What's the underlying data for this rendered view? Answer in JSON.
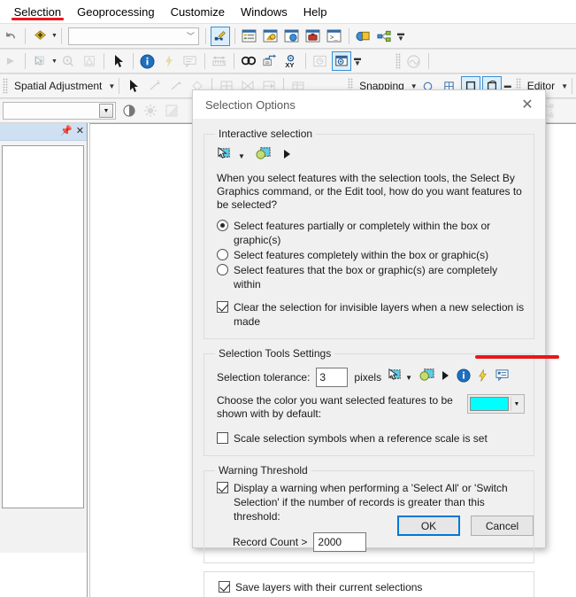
{
  "menu": {
    "clipped_left": ":",
    "items": [
      {
        "label": "Selection",
        "underlined": true
      },
      {
        "label": "Geoprocessing",
        "underlined": false
      },
      {
        "label": "Customize",
        "underlined": false
      },
      {
        "label": "Windows",
        "underlined": false
      },
      {
        "label": "Help",
        "underlined": false
      }
    ]
  },
  "toolbars": {
    "row1": {
      "combo_value": "",
      "icons": [
        "undo-icon",
        "add-data-icon",
        "dropdown-arrow-icon",
        "editor-toolbar-icon",
        "table-of-contents-icon",
        "catalog-icon",
        "search-window-icon",
        "arctoolbox-icon",
        "python-window-icon",
        "model-builder-icon",
        "geodatabase-icon",
        "overflow-icon"
      ]
    },
    "row2": {
      "icons": [
        "select-features-icon",
        "select-by-rectangle-icon",
        "zoom-in-selection-icon",
        "clear-selection-icon",
        "pointer-icon",
        "identify-icon",
        "hyperlink-icon",
        "html-popup-icon",
        "measure-icon",
        "find-icon",
        "find-route-icon",
        "go-to-xy-icon",
        "time-slider-icon",
        "create-viewer-window-icon",
        "overflow-icon",
        "geostatistical-analyst-icon",
        "help-icon"
      ]
    },
    "row3": {
      "spatial_adjustment_label": "Spatial Adjustment",
      "snapping_label": "Snapping",
      "editor_label": "Editor",
      "icons": [
        "pointer-icon",
        "new-displacement-link-icon",
        "new-identity-link-icon",
        "select-links-icon",
        "grid-icon",
        "edge-match-icon",
        "attribute-transfer-icon",
        "snapping-point-icon",
        "snapping-end-icon",
        "snapping-vertex-icon",
        "snapping-edge-icon"
      ]
    },
    "row4": {
      "combo_value": "",
      "icons": [
        "contrast-icon",
        "brightness-icon",
        "transparency-icon",
        "layout-grid-icon",
        "layout-guides-icon"
      ]
    }
  },
  "left_panel": {
    "name": "table-of-contents",
    "pin_icon": "pin-icon",
    "close_icon": "close-icon"
  },
  "dialog": {
    "title": "Selection Options",
    "close_icon": "close-icon",
    "interactive_selection": {
      "legend": "Interactive selection",
      "icons": [
        "select-features-icon",
        "dropdown-arrow-icon",
        "select-by-graphics-icon",
        "pointer-icon"
      ],
      "description": "When you select features with the selection tools, the Select By Graphics command, or the Edit tool, how do you want features to be selected?",
      "options": [
        {
          "label": "Select features partially or completely within the box or graphic(s)",
          "selected": true
        },
        {
          "label": "Select features completely within the box or graphic(s)",
          "selected": false
        },
        {
          "label": "Select features that the box or graphic(s) are completely within",
          "selected": false
        }
      ],
      "clear_selection_checkbox": {
        "label": "Clear the selection for invisible layers when a new selection is made",
        "checked": true
      }
    },
    "selection_tools_settings": {
      "legend": "Selection Tools Settings",
      "tolerance_label": "Selection tolerance:",
      "tolerance_value": "3",
      "pixels_label": "pixels",
      "tolerance_icons": [
        "select-features-icon",
        "dropdown-arrow-icon",
        "select-by-graphics-icon",
        "pointer-icon",
        "identify-icon",
        "hyperlink-icon",
        "html-popup-icon"
      ],
      "color_label": "Choose the color you want selected features to be shown with by default:",
      "color_value": "#00FFFF",
      "color_dropdown_icon": "chevron-down-icon",
      "scale_symbols_checkbox": {
        "label": "Scale selection symbols when a reference scale is set",
        "checked": false
      }
    },
    "warning_threshold": {
      "legend": "Warning Threshold",
      "display_warning_checkbox": {
        "label": "Display a warning when performing a 'Select All' or 'Switch Selection' if the number of records is greater than this threshold:",
        "checked": true
      },
      "record_count_label": "Record Count >",
      "record_count_value": "2000"
    },
    "save_layers_checkbox": {
      "label": "Save layers with their current selections",
      "checked": true
    },
    "buttons": {
      "ok": "OK",
      "cancel": "Cancel"
    }
  },
  "annotations": {
    "accent_color": "#e8171b",
    "menu_highlight": "Selection",
    "color_swatch_highlight": "#00FFFF"
  }
}
